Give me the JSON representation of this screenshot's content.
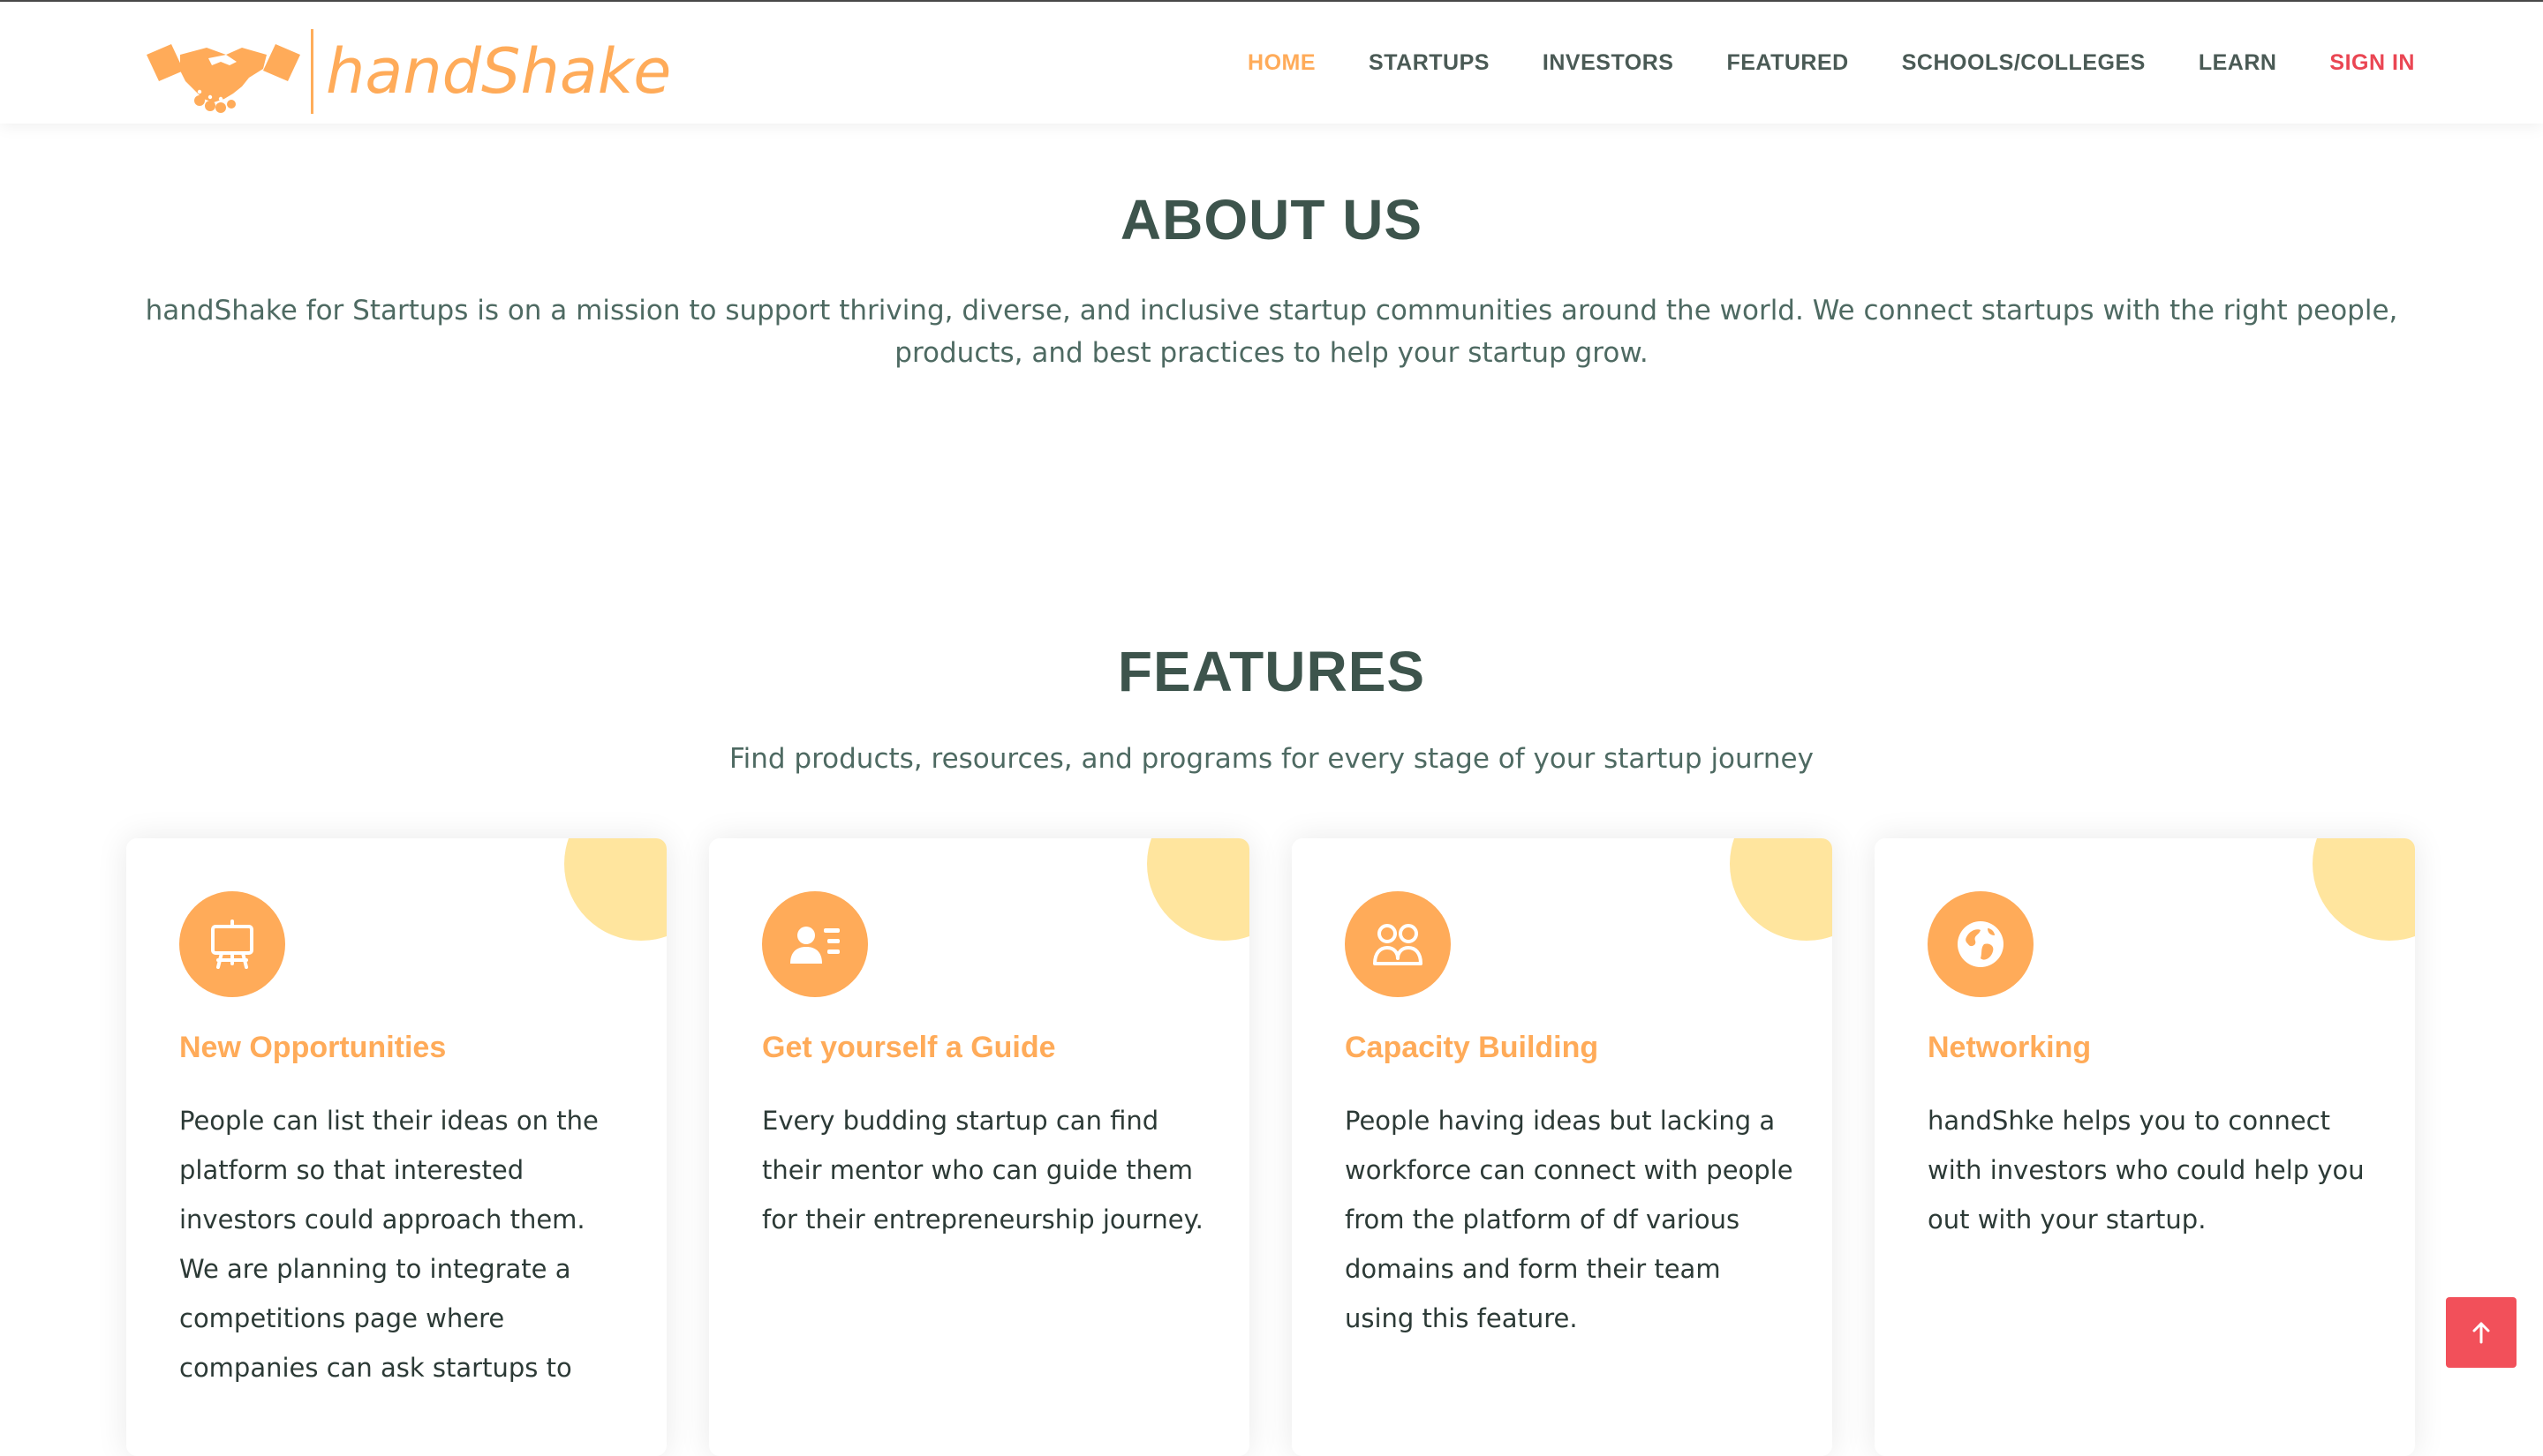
{
  "brand": {
    "name": "handShake",
    "accent": "#ffab59",
    "logo_icon": "handshake-icon"
  },
  "nav": {
    "items": [
      {
        "label": "HOME",
        "active": true
      },
      {
        "label": "STARTUPS"
      },
      {
        "label": "INVESTORS"
      },
      {
        "label": "FEATURED"
      },
      {
        "label": "SCHOOLS/COLLEGES"
      },
      {
        "label": "LEARN"
      },
      {
        "label": "SIGN IN",
        "color": "#ea4653"
      }
    ]
  },
  "about": {
    "title": "ABOUT US",
    "text": "handShake for Startups is on a mission to support thriving, diverse, and inclusive startup communities around the world. We connect startups with the right people, products, and best practices to help your startup grow."
  },
  "features": {
    "title": "FEATURES",
    "subtitle": "Find products, resources, and programs for every stage of your startup journey",
    "cards": [
      {
        "icon": "presentation-board-icon",
        "title": "New Opportunities",
        "text": "People can list their ideas on the platform so that interested investors could approach them. We are planning to integrate a competitions page where companies can ask startups to"
      },
      {
        "icon": "person-card-icon",
        "title": "Get yourself a Guide",
        "text": "Every budding startup can find their mentor who can guide them for their entrepreneurship journey."
      },
      {
        "icon": "people-icon",
        "title": "Capacity Building",
        "text": "People having ideas but lacking a workforce can connect with people from the platform of df various domains and form their team using this feature."
      },
      {
        "icon": "globe-icon",
        "title": "Networking",
        "text": "handShke helps you to connect with investors who could help you out with your startup."
      }
    ]
  },
  "back_to_top": {
    "icon": "arrow-up-icon",
    "color": "#f2505a"
  }
}
